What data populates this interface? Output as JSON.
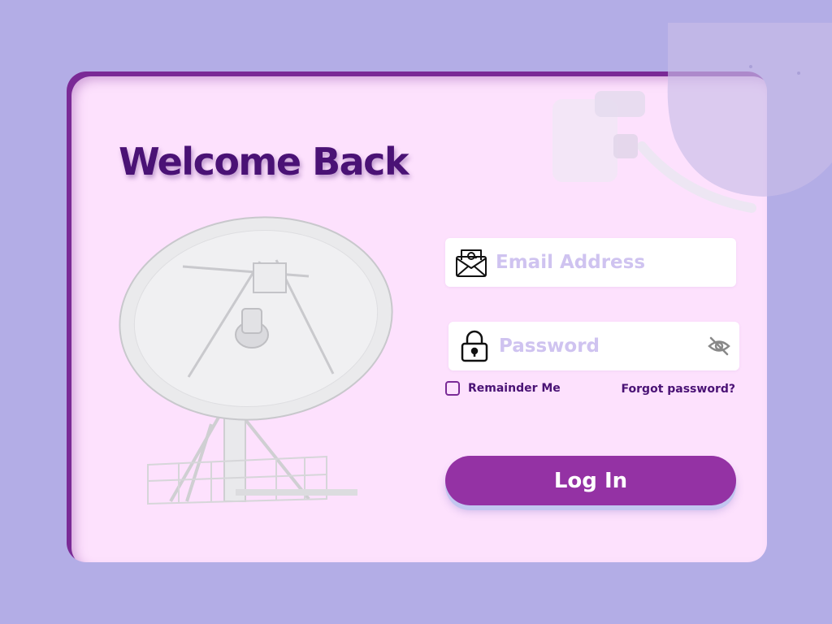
{
  "title": "Welcome Back",
  "email": {
    "placeholder": "Email Address",
    "value": ""
  },
  "password": {
    "placeholder": "Password",
    "value": ""
  },
  "remember": {
    "label": "Remainder Me",
    "checked": false
  },
  "forgot_label": "Forgot password?",
  "login_label": "Log In",
  "colors": {
    "background": "#b3ade6",
    "card": "#fde1fd",
    "title": "#4a1275",
    "button": "#9432a4",
    "placeholder": "#cfc3f0"
  },
  "icons": [
    "email-envelope-icon",
    "lock-icon",
    "eye-slash-icon"
  ]
}
